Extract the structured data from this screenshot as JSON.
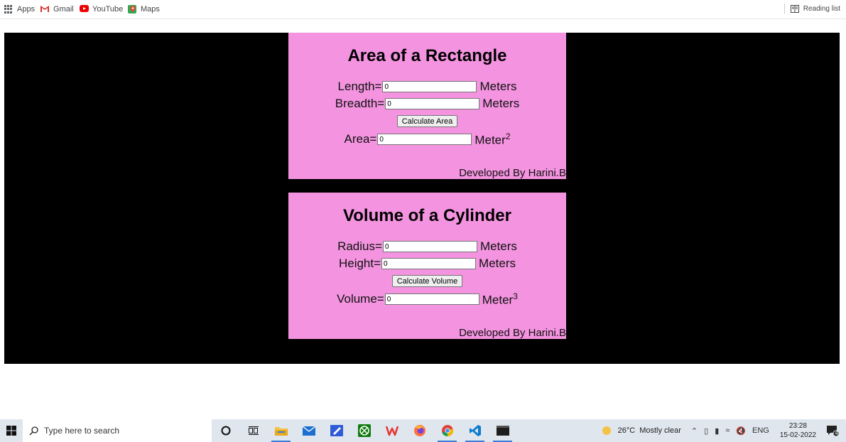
{
  "bookmarks": [
    {
      "label": "Apps",
      "icon": "apps-grid-icon"
    },
    {
      "label": "Gmail",
      "icon": "gmail-icon"
    },
    {
      "label": "YouTube",
      "icon": "youtube-icon"
    },
    {
      "label": "Maps",
      "icon": "maps-icon"
    }
  ],
  "reading_list": "Reading list",
  "rectangle": {
    "title": "Area of a Rectangle",
    "length_label": "Length=",
    "length_value": "0",
    "length_unit": "Meters",
    "breadth_label": "Breadth=",
    "breadth_value": "0",
    "breadth_unit": "Meters",
    "button": "Calculate Area",
    "area_label": "Area=",
    "area_value": "0",
    "area_unit": "Meter",
    "area_exp": "2",
    "footer": "Developed By Harini.B"
  },
  "cylinder": {
    "title": "Volume of a Cylinder",
    "radius_label": "Radius=",
    "radius_value": "0",
    "radius_unit": "Meters",
    "height_label": "Height=",
    "height_value": "0",
    "height_unit": "Meters",
    "button": "Calculate Volume",
    "volume_label": "Volume=",
    "volume_value": "0",
    "volume_unit": "Meter",
    "volume_exp": "3",
    "footer": "Developed By Harini.B"
  },
  "taskbar": {
    "search_placeholder": "Type here to search",
    "temperature": "26°C",
    "weather": "Mostly clear",
    "language": "ENG",
    "time": "23:28",
    "date": "15-02-2022",
    "notifications": "4"
  },
  "colors": {
    "card_bg": "#f494e0",
    "stage_bg": "#000000",
    "taskbar_bg": "#dfe6ee"
  }
}
